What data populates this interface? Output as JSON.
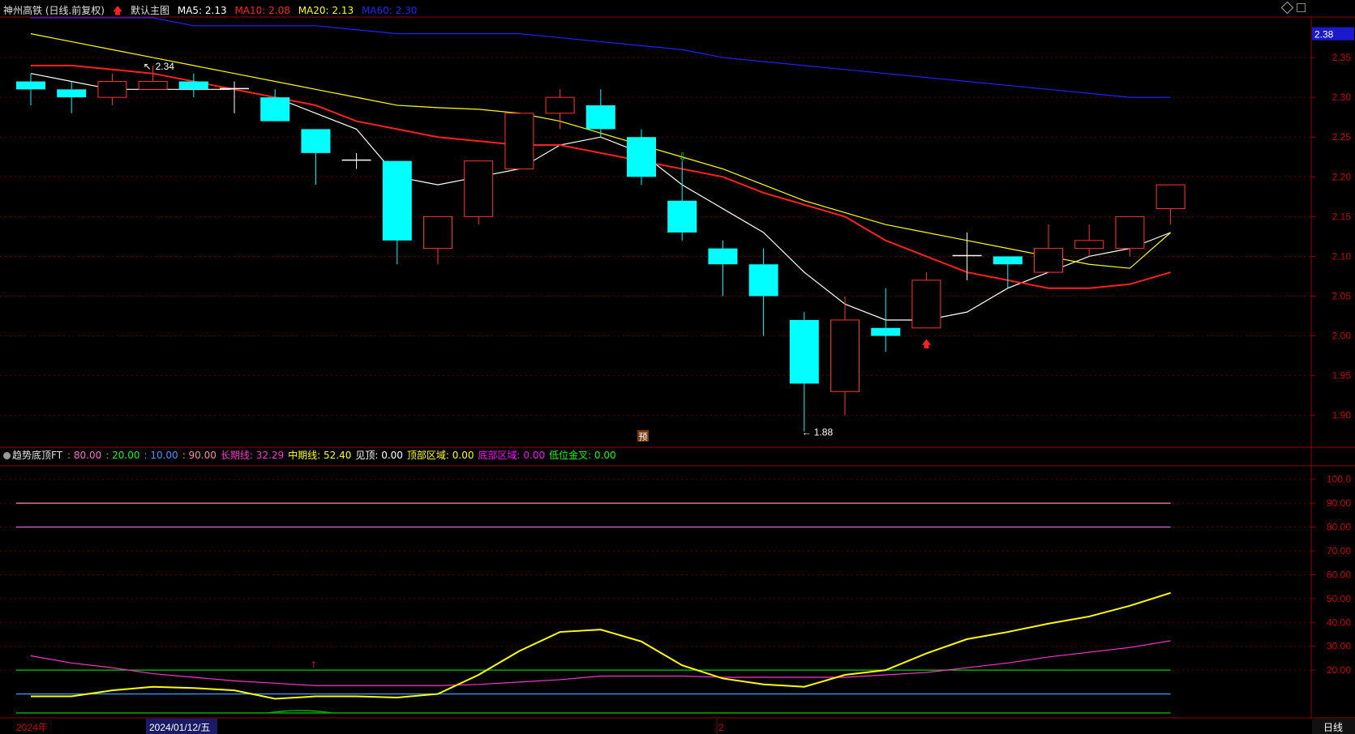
{
  "header": {
    "stock_name": "神州高铁 (日线.前复权)",
    "arrow_icon": "red-up-arrow-icon",
    "main_chart_label": "默认主图",
    "ma5": {
      "label": "MA5: 2.13",
      "color": "#ffffff"
    },
    "ma10": {
      "label": "MA10: 2.08",
      "color": "#ff2020"
    },
    "ma20": {
      "label": "MA20: 2.13",
      "color": "#ffff00"
    },
    "ma60": {
      "label": "MA60: 2.30",
      "color": "#2020ff"
    }
  },
  "price_axis": {
    "current_price": "2.38",
    "ticks": [
      "2.35",
      "2.30",
      "2.25",
      "2.20",
      "2.15",
      "2.10",
      "2.05",
      "2.00",
      "1.95",
      "1.90"
    ]
  },
  "indicator": {
    "name": "趋势底顶FT",
    "params": [
      {
        "text": ": 80.00",
        "color": "#ff66cc"
      },
      {
        "text": ": 20.00",
        "color": "#00ff00"
      },
      {
        "text": ": 10.00",
        "color": "#3399ff"
      },
      {
        "text": ": 90.00",
        "color": "#ff88aa"
      },
      {
        "text": "长期线: 32.29",
        "color": "#ff33cc"
      },
      {
        "text": "中期线: 52.40",
        "color": "#ffff00"
      },
      {
        "text": "见顶: 0.00",
        "color": "#ffffff"
      },
      {
        "text": "顶部区域: 0.00",
        "color": "#ffff00"
      },
      {
        "text": "底部区域: 0.00",
        "color": "#ff00ff"
      },
      {
        "text": "低位金叉: 0.00",
        "color": "#00ff00"
      }
    ],
    "axis_ticks": [
      "100.0",
      "90.00",
      "80.00",
      "70.00",
      "60.00",
      "50.00",
      "40.00",
      "30.00",
      "20.00"
    ]
  },
  "annotations": {
    "high_label": "2.34",
    "low_label": "1.88",
    "forecast_badge": "预"
  },
  "bottom_bar": {
    "year_label": "2024年",
    "date_label": "2024/01/12/五",
    "month_label": "2",
    "period_button": "日线"
  },
  "chart_data": [
    {
      "type": "candlestick",
      "title": "神州高铁 (日线.前复权)",
      "ylim": [
        1.86,
        2.4
      ],
      "candles": [
        {
          "o": 2.32,
          "h": 2.33,
          "l": 2.29,
          "c": 2.31
        },
        {
          "o": 2.31,
          "h": 2.32,
          "l": 2.28,
          "c": 2.3
        },
        {
          "o": 2.3,
          "h": 2.33,
          "l": 2.29,
          "c": 2.32
        },
        {
          "o": 2.31,
          "h": 2.34,
          "l": 2.31,
          "c": 2.32
        },
        {
          "o": 2.32,
          "h": 2.33,
          "l": 2.3,
          "c": 2.31
        },
        {
          "o": 2.311,
          "h": 2.32,
          "l": 2.28,
          "c": 2.309
        },
        {
          "o": 2.3,
          "h": 2.31,
          "l": 2.27,
          "c": 2.27
        },
        {
          "o": 2.26,
          "h": 2.26,
          "l": 2.19,
          "c": 2.23
        },
        {
          "o": 2.221,
          "h": 2.23,
          "l": 2.21,
          "c": 2.219
        },
        {
          "o": 2.22,
          "h": 2.22,
          "l": 2.09,
          "c": 2.12
        },
        {
          "o": 2.11,
          "h": 2.15,
          "l": 2.09,
          "c": 2.15
        },
        {
          "o": 2.15,
          "h": 2.22,
          "l": 2.14,
          "c": 2.22
        },
        {
          "o": 2.21,
          "h": 2.28,
          "l": 2.21,
          "c": 2.28
        },
        {
          "o": 2.28,
          "h": 2.31,
          "l": 2.26,
          "c": 2.3
        },
        {
          "o": 2.29,
          "h": 2.31,
          "l": 2.25,
          "c": 2.26
        },
        {
          "o": 2.25,
          "h": 2.26,
          "l": 2.19,
          "c": 2.2
        },
        {
          "o": 2.17,
          "h": 2.22,
          "l": 2.12,
          "c": 2.13
        },
        {
          "o": 2.11,
          "h": 2.12,
          "l": 2.05,
          "c": 2.09
        },
        {
          "o": 2.09,
          "h": 2.11,
          "l": 2.0,
          "c": 2.05
        },
        {
          "o": 2.02,
          "h": 2.03,
          "l": 1.88,
          "c": 1.94
        },
        {
          "o": 1.93,
          "h": 2.05,
          "l": 1.9,
          "c": 2.02
        },
        {
          "o": 2.01,
          "h": 2.06,
          "l": 1.98,
          "c": 2.0
        },
        {
          "o": 2.01,
          "h": 2.08,
          "l": 2.01,
          "c": 2.07
        },
        {
          "o": 2.101,
          "h": 2.13,
          "l": 2.07,
          "c": 2.099
        },
        {
          "o": 2.1,
          "h": 2.1,
          "l": 2.06,
          "c": 2.09
        },
        {
          "o": 2.08,
          "h": 2.14,
          "l": 2.08,
          "c": 2.11
        },
        {
          "o": 2.11,
          "h": 2.14,
          "l": 2.1,
          "c": 2.12
        },
        {
          "o": 2.11,
          "h": 2.15,
          "l": 2.1,
          "c": 2.15
        },
        {
          "o": 2.16,
          "h": 2.19,
          "l": 2.14,
          "c": 2.19
        }
      ],
      "series": [
        {
          "name": "MA5",
          "color": "#ffffff",
          "values": [
            2.33,
            2.32,
            2.31,
            2.31,
            2.31,
            2.31,
            2.3,
            2.28,
            2.26,
            2.2,
            2.19,
            2.2,
            2.21,
            2.24,
            2.25,
            2.23,
            2.19,
            2.16,
            2.13,
            2.08,
            2.04,
            2.02,
            2.02,
            2.03,
            2.06,
            2.08,
            2.1,
            2.11,
            2.13
          ]
        },
        {
          "name": "MA10",
          "color": "#ff2020",
          "values": [
            2.34,
            2.34,
            2.335,
            2.33,
            2.32,
            2.31,
            2.3,
            2.29,
            2.27,
            2.26,
            2.25,
            2.245,
            2.24,
            2.24,
            2.23,
            2.22,
            2.21,
            2.2,
            2.18,
            2.165,
            2.15,
            2.12,
            2.1,
            2.08,
            2.07,
            2.06,
            2.06,
            2.065,
            2.08
          ]
        },
        {
          "name": "MA20",
          "color": "#ffff00",
          "values": [
            2.38,
            2.37,
            2.36,
            2.35,
            2.34,
            2.33,
            2.32,
            2.31,
            2.3,
            2.29,
            2.287,
            2.285,
            2.28,
            2.27,
            2.255,
            2.24,
            2.225,
            2.21,
            2.19,
            2.17,
            2.155,
            2.14,
            2.13,
            2.12,
            2.11,
            2.1,
            2.09,
            2.085,
            2.13
          ]
        },
        {
          "name": "MA60",
          "color": "#2020ff",
          "values": [
            2.4,
            2.4,
            2.4,
            2.4,
            2.39,
            2.39,
            2.39,
            2.39,
            2.385,
            2.38,
            2.38,
            2.38,
            2.38,
            2.375,
            2.37,
            2.365,
            2.36,
            2.35,
            2.345,
            2.34,
            2.335,
            2.33,
            2.325,
            2.32,
            2.315,
            2.31,
            2.305,
            2.3,
            2.3
          ]
        }
      ]
    },
    {
      "type": "line",
      "title": "趋势底顶FT",
      "ylim": [
        0,
        105
      ],
      "hlines": [
        {
          "value": 90,
          "color": "#ff88aa"
        },
        {
          "value": 80,
          "color": "#cc66cc"
        },
        {
          "value": 20,
          "color": "#00cc00"
        },
        {
          "value": 10,
          "color": "#3399ff"
        }
      ],
      "series": [
        {
          "name": "长期线",
          "color": "#ff33cc",
          "values": [
            26,
            23,
            21,
            18.5,
            17,
            15.5,
            14.5,
            13.5,
            13.5,
            13.5,
            13.5,
            14,
            15,
            16,
            17.5,
            17.5,
            17.5,
            17,
            17,
            17,
            17,
            18,
            19,
            21,
            23,
            25.5,
            27.5,
            29.5,
            32.3
          ]
        },
        {
          "name": "中期线",
          "color": "#ffff00",
          "values": [
            9,
            9,
            11.5,
            13,
            12.5,
            11.5,
            8,
            9,
            9,
            8.5,
            10,
            18,
            28,
            36,
            37,
            32,
            22,
            16.5,
            14,
            13,
            18,
            20,
            27,
            33,
            36,
            39.5,
            42.5,
            47,
            52.4
          ]
        }
      ]
    }
  ]
}
